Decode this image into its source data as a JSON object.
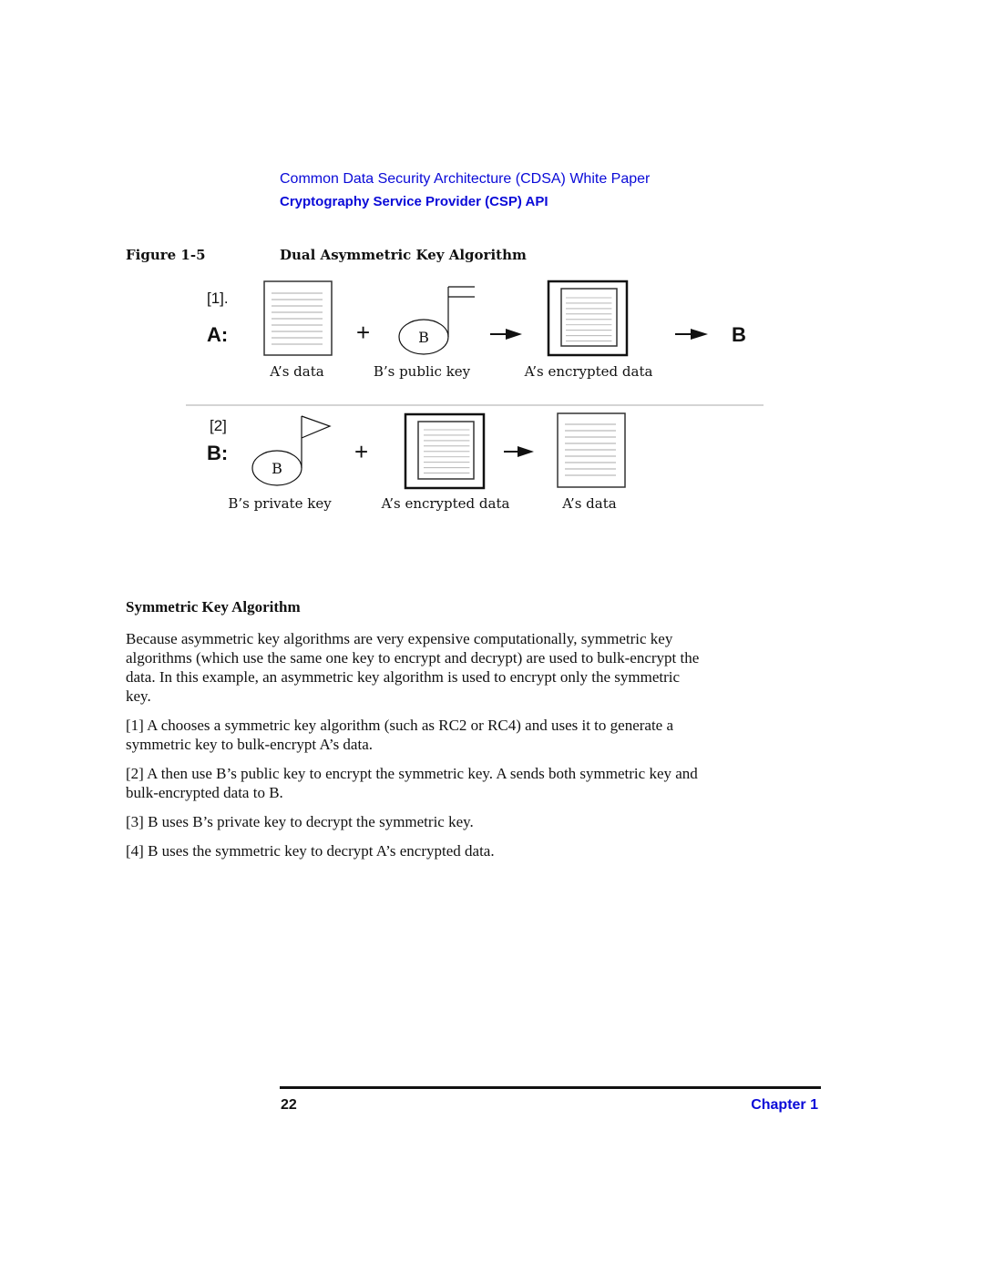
{
  "header": {
    "title": "Common Data Security Architecture (CDSA) White Paper",
    "subtitle": "Cryptography Service Provider (CSP) API",
    "accent_color": "#0a0ad8"
  },
  "figure": {
    "number": "Figure 1-5",
    "title": "Dual Asymmetric Key Algorithm",
    "step1": {
      "index": "[1].",
      "actor": "A:",
      "operator": "+",
      "key_letter": "B",
      "destination": "B",
      "labels": [
        "A’s data",
        "B’s public key",
        "A’s encrypted data"
      ],
      "icons": [
        "document-icon",
        "public-key-icon",
        "arrow-right-icon",
        "encrypted-document-icon",
        "arrow-right-icon"
      ]
    },
    "step2": {
      "index": "[2]",
      "actor": "B:",
      "operator": "+",
      "key_letter": "B",
      "labels": [
        "B’s private key",
        "A’s encrypted data",
        "A’s data"
      ],
      "icons": [
        "private-key-icon",
        "encrypted-document-icon",
        "arrow-right-icon",
        "document-icon"
      ]
    }
  },
  "section": {
    "title": "Symmetric Key Algorithm",
    "intro_lines": [
      "Because asymmetric key algorithms are very expensive computationally, symmetric key",
      "algorithms (which use the same one key to encrypt and decrypt) are used to bulk-encrypt the",
      "data.  In this example, an asymmetric key algorithm is used to encrypt only the symmetric",
      "key."
    ],
    "steps": [
      {
        "lines": [
          "[1] A chooses a symmetric key algorithm (such as RC2 or RC4) and uses it to generate a",
          "symmetric key to bulk-encrypt A’s data."
        ]
      },
      {
        "lines": [
          "[2] A then use B’s public key to encrypt the symmetric key.  A sends both symmetric key and",
          "bulk-encrypted data to B."
        ]
      },
      {
        "lines": [
          "[3] B uses B’s private key to decrypt the symmetric key."
        ]
      },
      {
        "lines": [
          "[4] B uses the symmetric key to decrypt A’s encrypted data."
        ]
      }
    ]
  },
  "footer": {
    "page_number": "22",
    "chapter": "Chapter 1"
  }
}
